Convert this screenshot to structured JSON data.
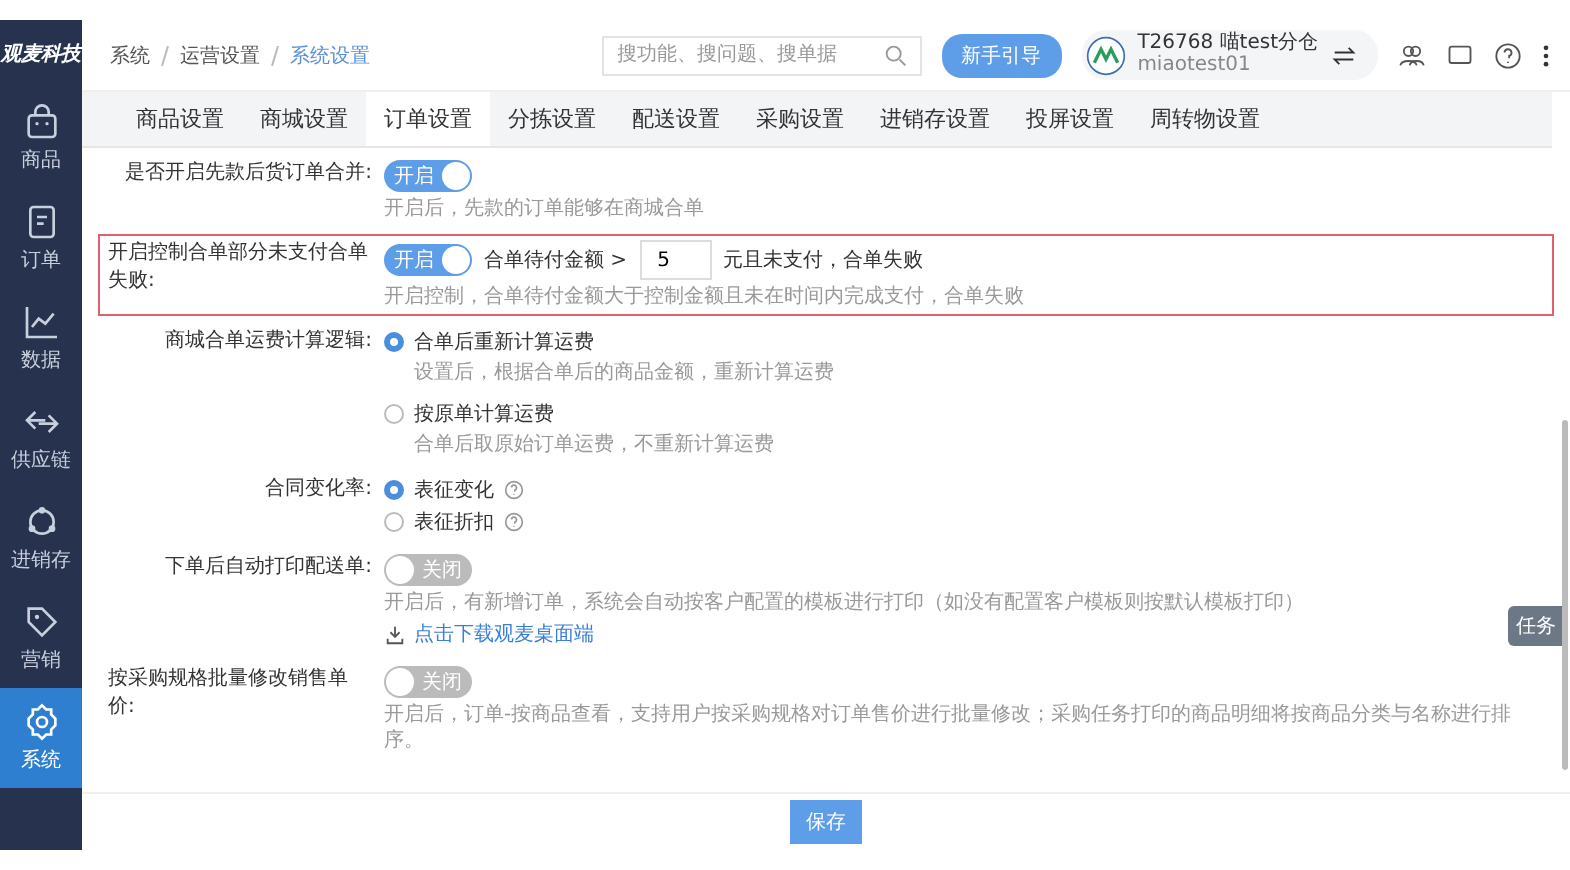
{
  "logo": "观麦科技",
  "sidebar": {
    "items": [
      {
        "label": "商品",
        "selected": false
      },
      {
        "label": "订单",
        "selected": false
      },
      {
        "label": "数据",
        "selected": false
      },
      {
        "label": "供应链",
        "selected": false
      },
      {
        "label": "进销存",
        "selected": false
      },
      {
        "label": "营销",
        "selected": false
      },
      {
        "label": "系统",
        "selected": true
      }
    ]
  },
  "breadcrumb": [
    "系统",
    "运营设置",
    "系统设置"
  ],
  "search": {
    "placeholder": "搜功能、搜问题、搜单据"
  },
  "guide_button": "新手引导",
  "account": {
    "name": "T26768 喵test分仓",
    "user": "miaotest01"
  },
  "tabs": [
    {
      "label": "商品设置",
      "selected": false
    },
    {
      "label": "商城设置",
      "selected": false
    },
    {
      "label": "订单设置",
      "selected": true
    },
    {
      "label": "分拣设置",
      "selected": false
    },
    {
      "label": "配送设置",
      "selected": false
    },
    {
      "label": "采购设置",
      "selected": false
    },
    {
      "label": "进销存设置",
      "selected": false
    },
    {
      "label": "投屏设置",
      "selected": false
    },
    {
      "label": "周转物设置",
      "selected": false
    }
  ],
  "settings": [
    {
      "kind": "toggle",
      "label": "是否开启先款后货订单合并:",
      "highlighted": false,
      "on": true,
      "toggle_text": "开启",
      "hint": "开启后，先款的订单能够在商城合单"
    },
    {
      "kind": "toggle",
      "label": "开启控制合单部分未支付合单失败:",
      "highlighted": true,
      "on": true,
      "toggle_text": "开启",
      "amount": {
        "prefix": "合单待付金额 >",
        "value": "5",
        "suffix": "元且未支付，合单失败"
      },
      "hint": "开启控制，合单待付金额大于控制金额且未在时间内完成支付，合单失败"
    },
    {
      "kind": "radio",
      "label": "商城合单运费计算逻辑:",
      "highlighted": false,
      "options": [
        {
          "label": "合单后重新计算运费",
          "selected": true,
          "help": false,
          "hint": "设置后，根据合单后的商品金额，重新计算运费"
        },
        {
          "label": "按原单计算运费",
          "selected": false,
          "help": false,
          "hint": "合单后取原始订单运费，不重新计算运费"
        }
      ]
    },
    {
      "kind": "radio",
      "label": "合同变化率:",
      "highlighted": false,
      "options": [
        {
          "label": "表征变化",
          "selected": true,
          "help": true
        },
        {
          "label": "表征折扣",
          "selected": false,
          "help": true
        }
      ]
    },
    {
      "kind": "toggle",
      "label": "下单后自动打印配送单:",
      "highlighted": false,
      "on": false,
      "toggle_text": "关闭",
      "hint": "开启后，有新增订单，系统会自动按客户配置的模板进行打印（如没有配置客户模板则按默认模板打印）",
      "link": "点击下载观麦桌面端"
    },
    {
      "kind": "toggle",
      "label": "按采购规格批量修改销售单价:",
      "highlighted": false,
      "on": false,
      "toggle_text": "关闭",
      "hint": "开启后，订单-按商品查看，支持用户按采购规格对订单售价进行批量修改；采购任务打印的商品明细将按商品分类与名称进行排序。"
    }
  ],
  "save_button": "保存",
  "task_tab": "任务"
}
